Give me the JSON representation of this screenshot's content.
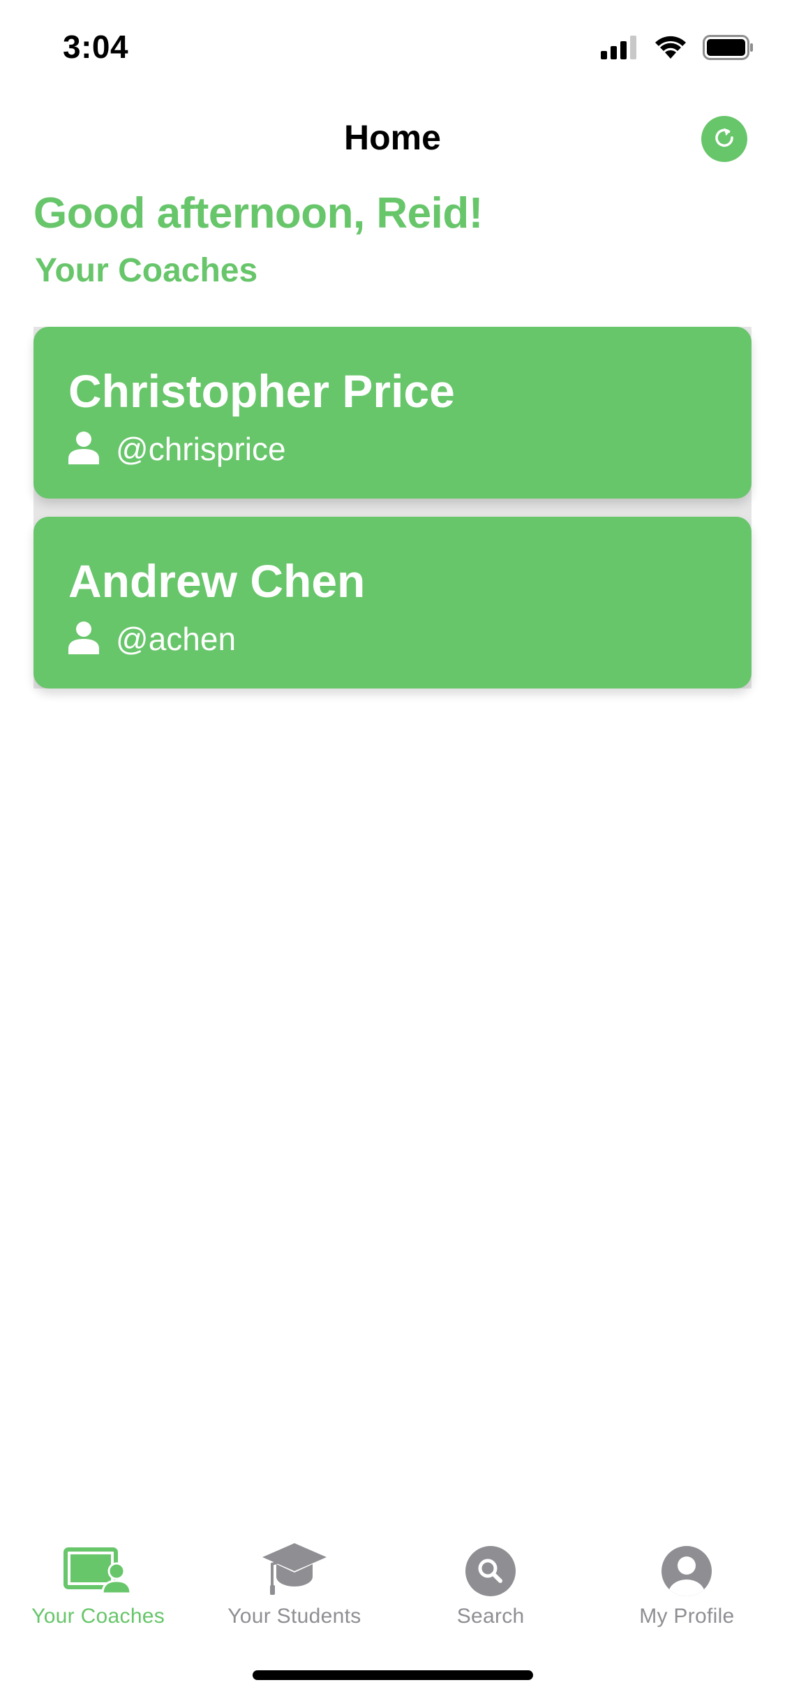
{
  "status_bar": {
    "time": "3:04"
  },
  "header": {
    "title": "Home",
    "refresh_icon": "refresh-icon"
  },
  "greeting": "Good afternoon, Reid!",
  "section_title": "Your Coaches",
  "coaches": [
    {
      "name": "Christopher Price",
      "handle": "@chrisprice"
    },
    {
      "name": "Andrew Chen",
      "handle": "@achen"
    }
  ],
  "tabs": [
    {
      "label": "Your Coaches",
      "icon": "coaches-icon",
      "active": true
    },
    {
      "label": "Your Students",
      "icon": "graduation-cap-icon",
      "active": false
    },
    {
      "label": "Search",
      "icon": "search-icon",
      "active": false
    },
    {
      "label": "My Profile",
      "icon": "profile-icon",
      "active": false
    }
  ],
  "colors": {
    "accent": "#67C56A",
    "tab_inactive": "#8E8E93"
  }
}
